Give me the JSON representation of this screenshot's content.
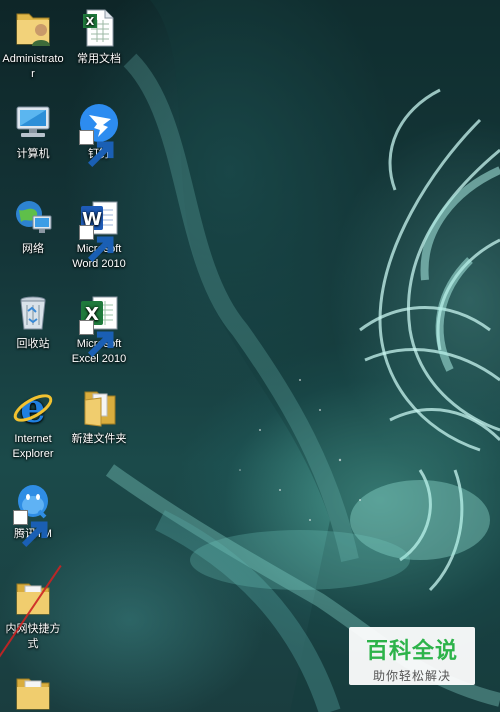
{
  "desktop": {
    "icons": [
      {
        "id": "administrator",
        "label": "Administrator",
        "icon": "user-folder-icon"
      },
      {
        "id": "changyong",
        "label": "常用文档",
        "icon": "excel-document-icon"
      },
      {
        "id": "computer",
        "label": "计算机",
        "icon": "computer-icon"
      },
      {
        "id": "dingding",
        "label": "钉钉",
        "icon": "dingtalk-icon"
      },
      {
        "id": "network",
        "label": "网络",
        "icon": "network-icon"
      },
      {
        "id": "word",
        "label": "Microsoft Word 2010",
        "icon": "word-icon"
      },
      {
        "id": "recycle",
        "label": "回收站",
        "icon": "recycle-bin-icon"
      },
      {
        "id": "excel",
        "label": "Microsoft Excel 2010",
        "icon": "excel-icon"
      },
      {
        "id": "ie",
        "label": "Internet Explorer",
        "icon": "internet-explorer-icon"
      },
      {
        "id": "newfolder",
        "label": "新建文件夹",
        "icon": "folder-icon"
      },
      {
        "id": "tim",
        "label": "腾讯TM",
        "icon": "tencent-tim-icon"
      },
      {
        "id": "intranet",
        "label": "内网快捷方式",
        "icon": "folder-icon"
      },
      {
        "id": "folder-bottom",
        "label": "",
        "icon": "folder-icon"
      }
    ]
  },
  "watermark": {
    "title": "百科全说",
    "subtitle": "助你轻松解决"
  },
  "colors": {
    "watermark_green": "#2db34a",
    "annotation_red": "#c22222"
  }
}
